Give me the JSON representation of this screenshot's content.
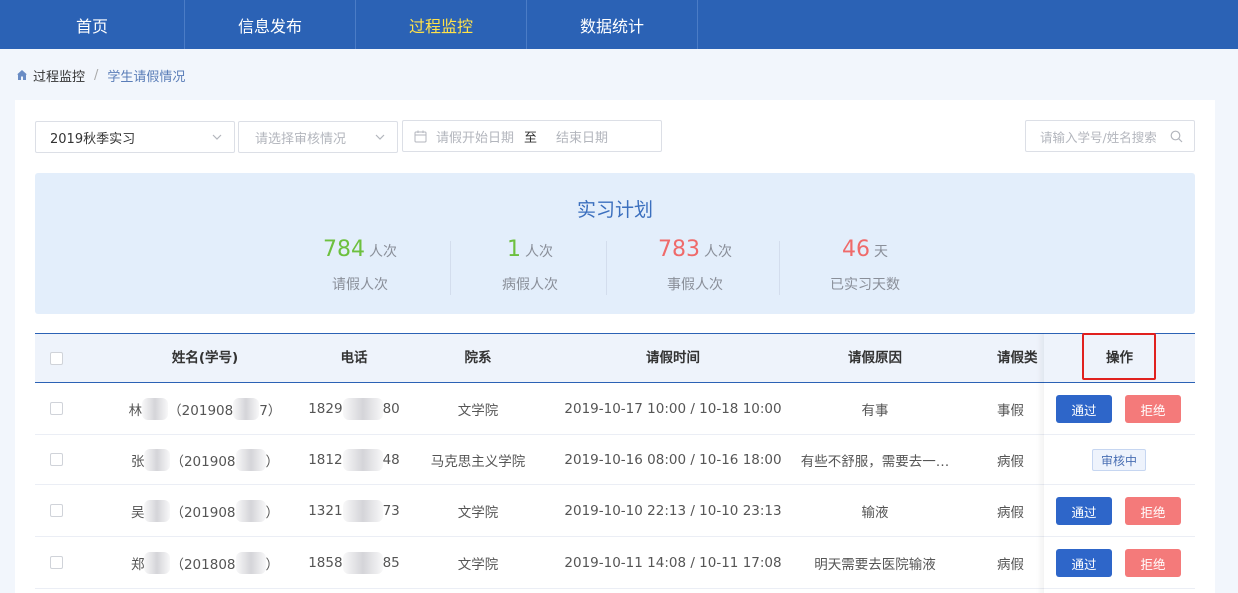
{
  "nav": {
    "items": [
      "首页",
      "信息发布",
      "过程监控",
      "数据统计"
    ]
  },
  "breadcrumb": {
    "parent": "过程监控",
    "separator": "/",
    "current": "学生请假情况"
  },
  "filters": {
    "semester": "2019秋季实习",
    "review_placeholder": "请选择审核情况",
    "start_date_placeholder": "请假开始日期",
    "date_separator": "至",
    "end_date_placeholder": "结束日期",
    "search_placeholder": "请输入学号/姓名搜索"
  },
  "stats": {
    "title": "实习计划",
    "items": [
      {
        "value": "784",
        "unit": "人次",
        "label": "请假人次"
      },
      {
        "value": "1",
        "unit": "人次",
        "label": "病假人次"
      },
      {
        "value": "783",
        "unit": "人次",
        "label": "事假人次"
      },
      {
        "value": "46",
        "unit": "天",
        "label": "已实习天数"
      }
    ]
  },
  "table": {
    "headers": {
      "name": "姓名(学号)",
      "phone": "电话",
      "dept": "院系",
      "time": "请假时间",
      "reason": "请假原因",
      "type": "请假类",
      "ops": "操作"
    },
    "rows": [
      {
        "name_prefix": "林",
        "id_prefix": "（201908",
        "id_suffix": "7）",
        "phone_prefix": "1829",
        "phone_suffix": "80",
        "dept": "文学院",
        "time": "2019-10-17 10:00 / 10-18 10:00",
        "reason": "有事",
        "type": "事假"
      },
      {
        "name_prefix": "张",
        "id_prefix": "（201908",
        "id_suffix": "）",
        "phone_prefix": "1812",
        "phone_suffix": "48",
        "dept": "马克思主义学院",
        "time": "2019-10-16 08:00 / 10-16 18:00",
        "reason": "有些不舒服，需要去一…",
        "type": "病假"
      },
      {
        "name_prefix": "吴",
        "id_prefix": "（201908",
        "id_suffix": "）",
        "phone_prefix": "1321",
        "phone_suffix": "73",
        "dept": "文学院",
        "time": "2019-10-10 22:13 / 10-10 23:13",
        "reason": "输液",
        "type": "病假"
      },
      {
        "name_prefix": "郑",
        "id_prefix": "（201808",
        "id_suffix": "）",
        "phone_prefix": "1858",
        "phone_suffix": "85",
        "dept": "文学院",
        "time": "2019-10-11 14:08 / 10-11 17:08",
        "reason": "明天需要去医院输液",
        "type": "病假"
      }
    ]
  },
  "actions": {
    "pass_label": "通过",
    "reject_label": "拒绝",
    "pending_label": "审核中"
  },
  "colors": {
    "nav_bg": "#2b62b5",
    "nav_active": "#ffe24a",
    "stat_green": "#6dc03f",
    "stat_red": "#ef6a6a",
    "pass_btn": "#2e66c9",
    "reject_btn": "#f47a7a",
    "highlight": "#e0201e"
  }
}
